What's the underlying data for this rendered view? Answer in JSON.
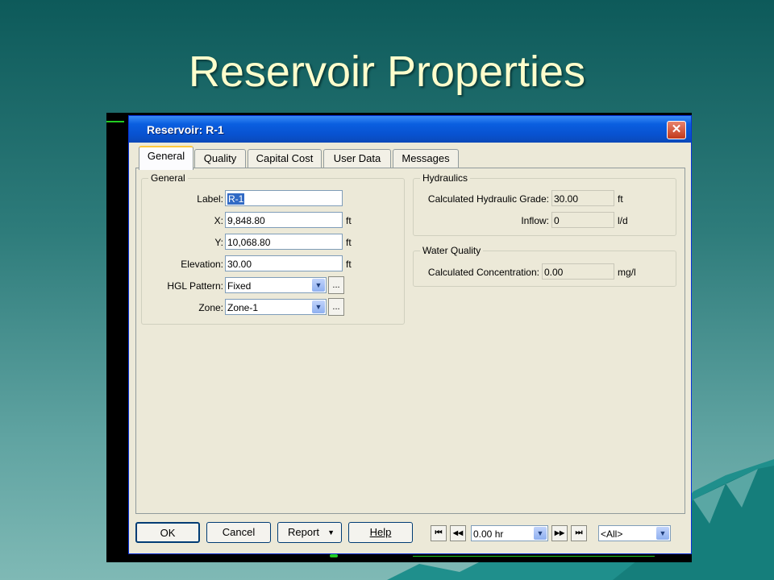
{
  "slide": {
    "title": "Reservoir Properties"
  },
  "dialog": {
    "title": "Reservoir: R-1",
    "close_glyph": "✕",
    "tabs": [
      {
        "label": "General"
      },
      {
        "label": "Quality"
      },
      {
        "label": "Capital Cost"
      },
      {
        "label": "User Data"
      },
      {
        "label": "Messages"
      }
    ],
    "general": {
      "legend": "General",
      "label_label": "Label:",
      "label_value": "R-1",
      "x_label": "X:",
      "x_value": "9,848.80",
      "x_unit": "ft",
      "y_label": "Y:",
      "y_value": "10,068.80",
      "y_unit": "ft",
      "elevation_label": "Elevation:",
      "elevation_value": "30.00",
      "elevation_unit": "ft",
      "hgl_label": "HGL Pattern:",
      "hgl_value": "Fixed",
      "zone_label": "Zone:",
      "zone_value": "Zone-1",
      "ellipsis": "..."
    },
    "hydraulics": {
      "legend": "Hydraulics",
      "hgl_label": "Calculated Hydraulic Grade:",
      "hgl_value": "30.00",
      "hgl_unit": "ft",
      "inflow_label": "Inflow:",
      "inflow_value": "0",
      "inflow_unit": "l/d"
    },
    "water_quality": {
      "legend": "Water Quality",
      "conc_label": "Calculated Concentration:",
      "conc_value": "0.00",
      "conc_unit": "mg/l"
    },
    "footer": {
      "ok": "OK",
      "cancel": "Cancel",
      "report": "Report",
      "help": "Help",
      "time_value": "0.00 hr",
      "filter_value": "<All>",
      "first_glyph": "⏮",
      "prev_glyph": "◀◀",
      "next_glyph": "▶▶",
      "last_glyph": "⏭"
    }
  },
  "colors": {
    "title_bar": "#0a5fe0",
    "slide_title": "#ffffcc",
    "dialog_bg": "#ece9d8"
  }
}
